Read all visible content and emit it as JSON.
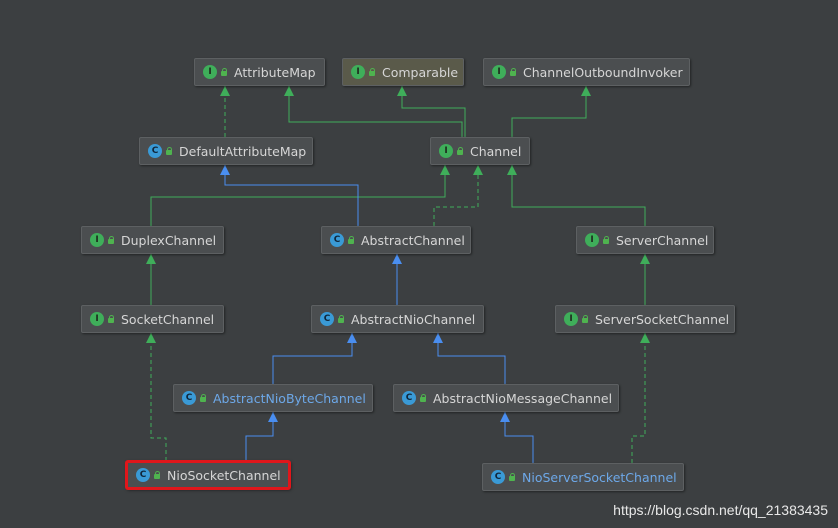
{
  "diagram": {
    "nodes": [
      {
        "id": "attributemap",
        "label": "AttributeMap",
        "kind": "interface"
      },
      {
        "id": "comparable",
        "label": "Comparable",
        "kind": "interface"
      },
      {
        "id": "channeloutboundinvoker",
        "label": "ChannelOutboundInvoker",
        "kind": "interface"
      },
      {
        "id": "defaultattributemap",
        "label": "DefaultAttributeMap",
        "kind": "class"
      },
      {
        "id": "channel",
        "label": "Channel",
        "kind": "interface"
      },
      {
        "id": "duplexchannel",
        "label": "DuplexChannel",
        "kind": "interface"
      },
      {
        "id": "abstractchannel",
        "label": "AbstractChannel",
        "kind": "abstract-class"
      },
      {
        "id": "serverchannel",
        "label": "ServerChannel",
        "kind": "interface"
      },
      {
        "id": "socketchannel",
        "label": "SocketChannel",
        "kind": "interface"
      },
      {
        "id": "abstractniochannel",
        "label": "AbstractNioChannel",
        "kind": "abstract-class"
      },
      {
        "id": "serversocketchannel",
        "label": "ServerSocketChannel",
        "kind": "interface"
      },
      {
        "id": "abstractniobytechannel",
        "label": "AbstractNioByteChannel",
        "kind": "abstract-class",
        "style": "abstract"
      },
      {
        "id": "abstractniomessagechannel",
        "label": "AbstractNioMessageChannel",
        "kind": "abstract-class"
      },
      {
        "id": "niosocketchannel",
        "label": "NioSocketChannel",
        "kind": "class",
        "selected": true
      },
      {
        "id": "nioserversocketchannel",
        "label": "NioServerSocketChannel",
        "kind": "class",
        "style": "abstract"
      }
    ],
    "edges": [
      {
        "from": "defaultattributemap",
        "to": "attributemap",
        "type": "implements"
      },
      {
        "from": "channel",
        "to": "attributemap",
        "type": "extends-interface"
      },
      {
        "from": "channel",
        "to": "comparable",
        "type": "extends-interface"
      },
      {
        "from": "channel",
        "to": "channeloutboundinvoker",
        "type": "extends-interface"
      },
      {
        "from": "duplexchannel",
        "to": "channel",
        "type": "extends-interface"
      },
      {
        "from": "abstractchannel",
        "to": "defaultattributemap",
        "type": "extends"
      },
      {
        "from": "abstractchannel",
        "to": "channel",
        "type": "implements"
      },
      {
        "from": "serverchannel",
        "to": "channel",
        "type": "extends-interface"
      },
      {
        "from": "socketchannel",
        "to": "duplexchannel",
        "type": "extends-interface"
      },
      {
        "from": "abstractniochannel",
        "to": "abstractchannel",
        "type": "extends"
      },
      {
        "from": "serversocketchannel",
        "to": "serverchannel",
        "type": "extends-interface"
      },
      {
        "from": "abstractniobytechannel",
        "to": "abstractniochannel",
        "type": "extends"
      },
      {
        "from": "abstractniomessagechannel",
        "to": "abstractniochannel",
        "type": "extends"
      },
      {
        "from": "niosocketchannel",
        "to": "abstractniobytechannel",
        "type": "extends"
      },
      {
        "from": "niosocketchannel",
        "to": "socketchannel",
        "type": "implements"
      },
      {
        "from": "nioserversocketchannel",
        "to": "abstractniomessagechannel",
        "type": "extends"
      },
      {
        "from": "nioserversocketchannel",
        "to": "serversocketchannel",
        "type": "implements"
      }
    ],
    "icon_letters": {
      "interface": "I",
      "class": "C"
    },
    "colors": {
      "background": "#3c3f41",
      "node_bg": "#4b4e50",
      "interface_edge": "#3fae5a",
      "class_edge": "#4a8ef0",
      "selection": "#e0161b",
      "abstract_text": "#6da8e8"
    }
  },
  "watermark": "https://blog.csdn.net/qq_21383435"
}
